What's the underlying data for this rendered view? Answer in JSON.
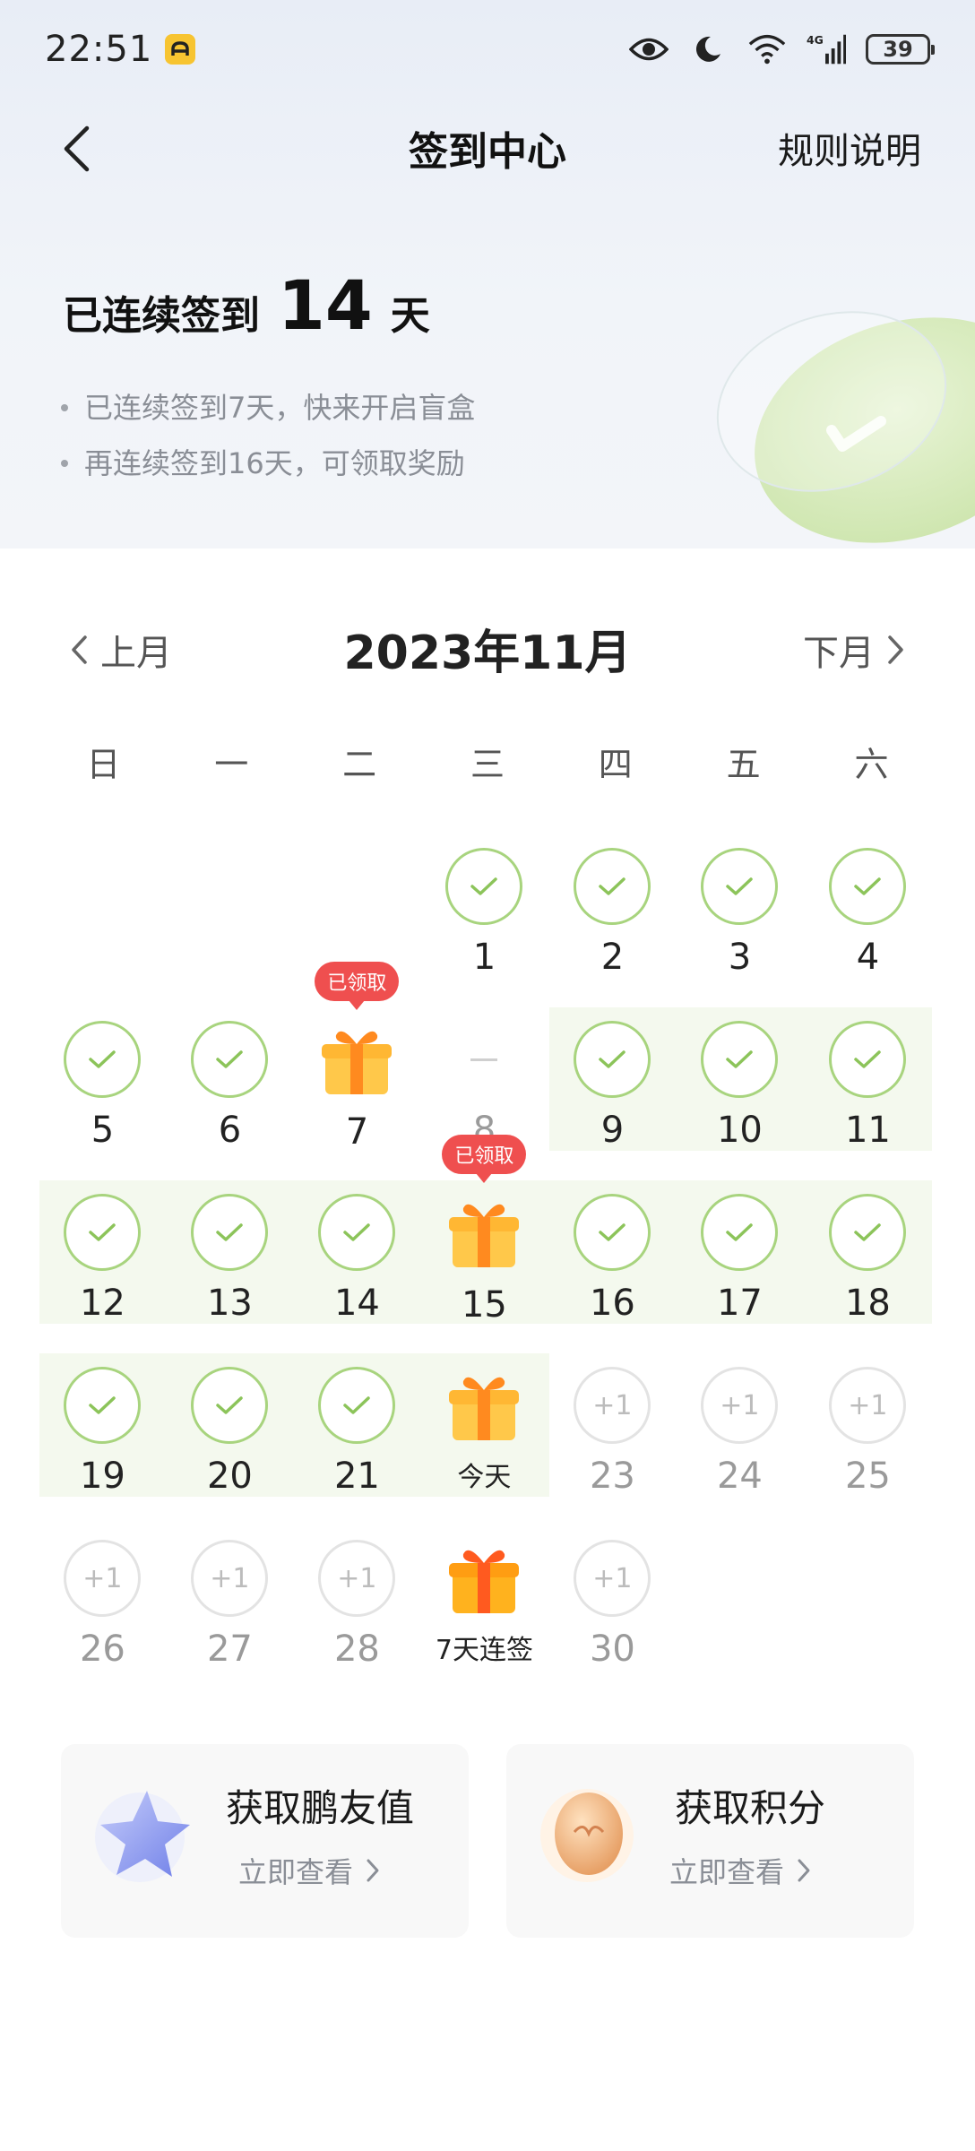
{
  "status_bar": {
    "time": "22:51",
    "battery": "39"
  },
  "nav": {
    "title": "签到中心",
    "rules": "规则说明"
  },
  "streak": {
    "prefix": "已连续签到",
    "days": "14",
    "unit": "天"
  },
  "tips": [
    "已连续签到7天，快来开启盲盒",
    "再连续签到16天，可领取奖励"
  ],
  "calendar": {
    "prev_label": "上月",
    "next_label": "下月",
    "month_title": "2023年11月",
    "weekdays": [
      "日",
      "一",
      "二",
      "三",
      "四",
      "五",
      "六"
    ],
    "received_label": "已领取",
    "today_label": "今天",
    "streak7_label": "7天连签",
    "plus_label": "+1",
    "days": {
      "d1": "1",
      "d2": "2",
      "d3": "3",
      "d4": "4",
      "d5": "5",
      "d6": "6",
      "d7": "7",
      "d8": "8",
      "d9": "9",
      "d10": "10",
      "d11": "11",
      "d12": "12",
      "d13": "13",
      "d14": "14",
      "d15": "15",
      "d16": "16",
      "d17": "17",
      "d18": "18",
      "d19": "19",
      "d20": "20",
      "d21": "21",
      "d23": "23",
      "d24": "24",
      "d25": "25",
      "d26": "26",
      "d27": "27",
      "d28": "28",
      "d30": "30"
    }
  },
  "cards": {
    "friend_value": {
      "title": "获取鹏友值",
      "link": "立即查看"
    },
    "points": {
      "title": "获取积分",
      "link": "立即查看"
    }
  },
  "colors": {
    "check_green": "#a8d47e",
    "band_green": "#f4f9ee",
    "received_red": "#ef4f4f",
    "gift_orange": "#f7a520"
  }
}
